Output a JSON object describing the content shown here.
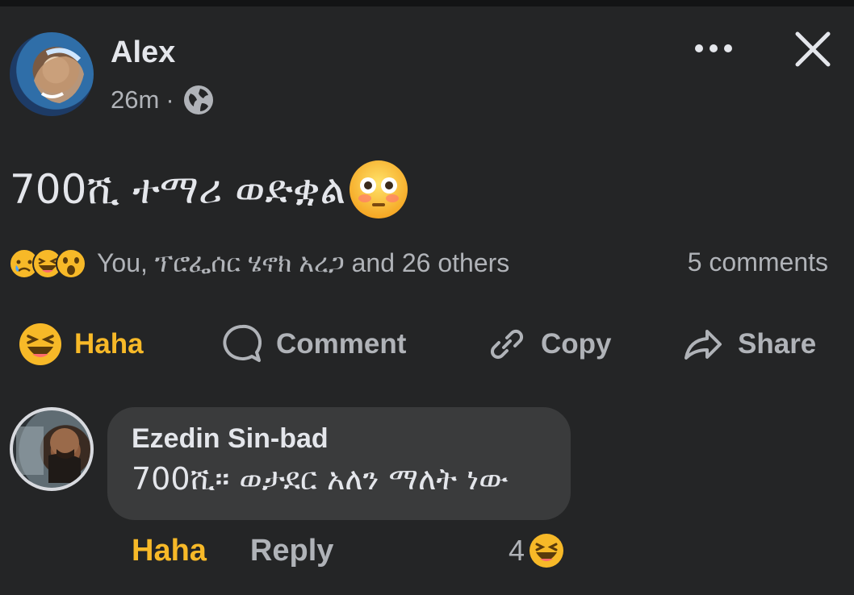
{
  "post": {
    "author": "Alex",
    "time": "26m",
    "separator": "·",
    "privacy_icon": "globe-icon",
    "text": "700ሺ ተማሪ ወድቋል",
    "emoji": "flushed-face"
  },
  "header": {
    "more_icon": "more-icon",
    "close_icon": "close-icon"
  },
  "reactions": {
    "icons": [
      "sad-face",
      "haha-face",
      "wow-face"
    ],
    "summary": "You, ፕሮፌሰር ሄኖክ አረጋ and 26 others",
    "comments_count": "5 comments"
  },
  "actions": {
    "haha": "Haha",
    "comment": "Comment",
    "copy": "Copy",
    "share": "Share"
  },
  "comment": {
    "author": "Ezedin Sin-bad",
    "text": "700ሺ። ወታደር አለን ማለት ነው",
    "haha": "Haha",
    "reply": "Reply",
    "reaction_count": "4"
  },
  "colors": {
    "background": "#242526",
    "bubble": "#3a3b3c",
    "text_primary": "#e4e6eb",
    "text_secondary": "#b0b3b8",
    "haha_accent": "#f7b928"
  }
}
